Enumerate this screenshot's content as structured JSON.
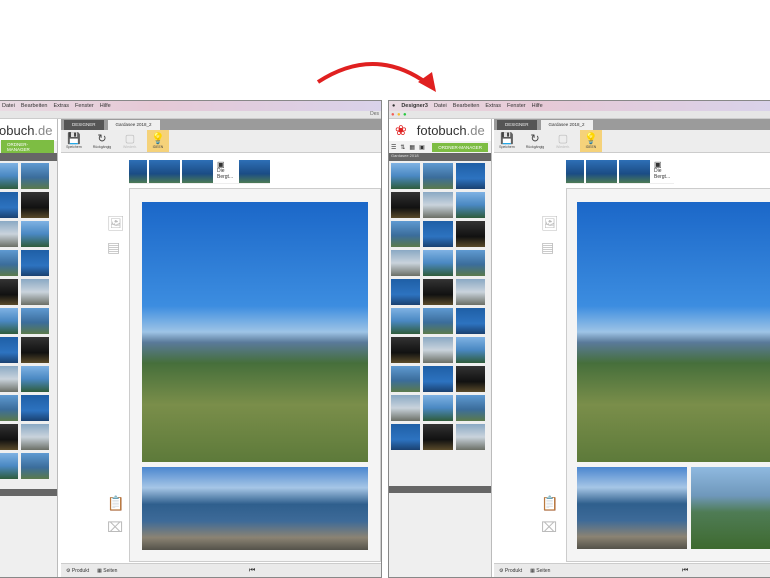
{
  "menu": {
    "app": "Designer3",
    "items": [
      "Datei",
      "Bearbeiten",
      "Extras",
      "Fenster",
      "Hilfe"
    ]
  },
  "title_partial": "Des",
  "logo": {
    "left": "obuch",
    "right": "fotobuch",
    "tld": ".de"
  },
  "sidebar": {
    "ordner_button": "ORDNER-MANAGER",
    "header": "Gardasee 2018"
  },
  "tabs": {
    "designer": "DESIGNER",
    "project": "Gardasee 2018_2"
  },
  "toolbar": {
    "save": "Speichern",
    "undo": "Rückgängig",
    "redo": "Wiederh.",
    "ideas": "IDEEN"
  },
  "strip": {
    "text_item": "Die Bergt..."
  },
  "bottom": {
    "produkt": "Produkt",
    "seiten": "Seiten"
  },
  "colors": {
    "arrow": "#e02020",
    "accent_green": "#7dbd43",
    "idea": "#f5d27a"
  }
}
